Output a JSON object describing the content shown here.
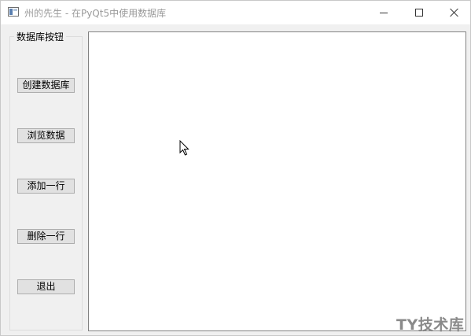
{
  "window": {
    "title": "州的先生 - 在PyQt5中使用数据库"
  },
  "group": {
    "title": "数据库按钮",
    "buttons": [
      {
        "label": "创建数据库"
      },
      {
        "label": "浏览数据"
      },
      {
        "label": "添加一行"
      },
      {
        "label": "删除一行"
      },
      {
        "label": "退出"
      }
    ]
  },
  "watermark": "TY技术库",
  "icons": {
    "app": "window-app-icon",
    "minimize": "minimize-icon",
    "maximize": "maximize-icon",
    "close": "close-icon",
    "cursor": "mouse-pointer-icon"
  }
}
